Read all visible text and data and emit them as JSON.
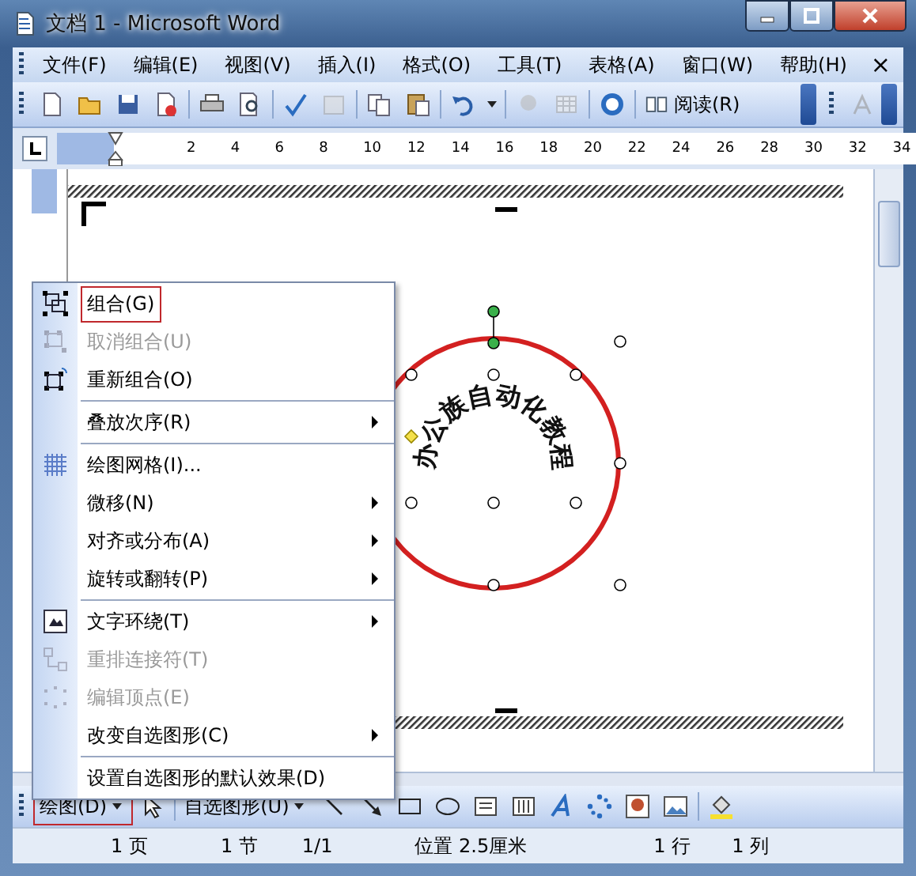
{
  "window": {
    "title": "文档 1 - Microsoft Word"
  },
  "menu_bar": {
    "items": [
      "文件(F)",
      "编辑(E)",
      "视图(V)",
      "插入(I)",
      "格式(O)",
      "工具(T)",
      "表格(A)",
      "窗口(W)",
      "帮助(H)"
    ],
    "close": "×"
  },
  "toolbar": {
    "read_button": "阅读(R)"
  },
  "ruler": {
    "ticks": [
      "2",
      "4",
      "6",
      "8",
      "10",
      "12",
      "14",
      "16",
      "18",
      "20",
      "22",
      "24",
      "26",
      "28",
      "30",
      "32",
      "34"
    ]
  },
  "wordart": {
    "text": "办公族自动化教程"
  },
  "context_menu": {
    "items": [
      {
        "label": "组合(G)",
        "kind": "group",
        "disabled": false,
        "submenu": false,
        "separator_before": false,
        "selected": true
      },
      {
        "label": "取消组合(U)",
        "kind": "ungroup",
        "disabled": true,
        "submenu": false,
        "separator_before": false,
        "selected": false
      },
      {
        "label": "重新组合(O)",
        "kind": "regroup",
        "disabled": false,
        "submenu": false,
        "separator_before": false,
        "selected": false
      },
      {
        "label": "叠放次序(R)",
        "kind": "plain",
        "disabled": false,
        "submenu": true,
        "separator_before": true,
        "selected": false
      },
      {
        "label": "绘图网格(I)...",
        "kind": "grid",
        "disabled": false,
        "submenu": false,
        "separator_before": true,
        "selected": false
      },
      {
        "label": "微移(N)",
        "kind": "plain",
        "disabled": false,
        "submenu": true,
        "separator_before": false,
        "selected": false
      },
      {
        "label": "对齐或分布(A)",
        "kind": "plain",
        "disabled": false,
        "submenu": true,
        "separator_before": false,
        "selected": false
      },
      {
        "label": "旋转或翻转(P)",
        "kind": "plain",
        "disabled": false,
        "submenu": true,
        "separator_before": false,
        "selected": false
      },
      {
        "label": "文字环绕(T)",
        "kind": "wrap",
        "disabled": false,
        "submenu": true,
        "separator_before": true,
        "selected": false
      },
      {
        "label": "重排连接符(T)",
        "kind": "connector",
        "disabled": true,
        "submenu": false,
        "separator_before": false,
        "selected": false
      },
      {
        "label": "编辑顶点(E)",
        "kind": "points",
        "disabled": true,
        "submenu": false,
        "separator_before": false,
        "selected": false
      },
      {
        "label": "改变自选图形(C)",
        "kind": "plain",
        "disabled": false,
        "submenu": true,
        "separator_before": false,
        "selected": false
      },
      {
        "label": "设置自选图形的默认效果(D)",
        "kind": "plain",
        "disabled": false,
        "submenu": false,
        "separator_before": true,
        "selected": false
      }
    ]
  },
  "drawing_toolbar": {
    "draw_button": {
      "label": "绘图(D)",
      "selected": true
    },
    "autoshapes_button": "自选图形(U)"
  },
  "status_bar": [
    "1 页",
    "1 节",
    "1/1",
    "位置 2.5厘米",
    "1 行",
    "1 列"
  ]
}
